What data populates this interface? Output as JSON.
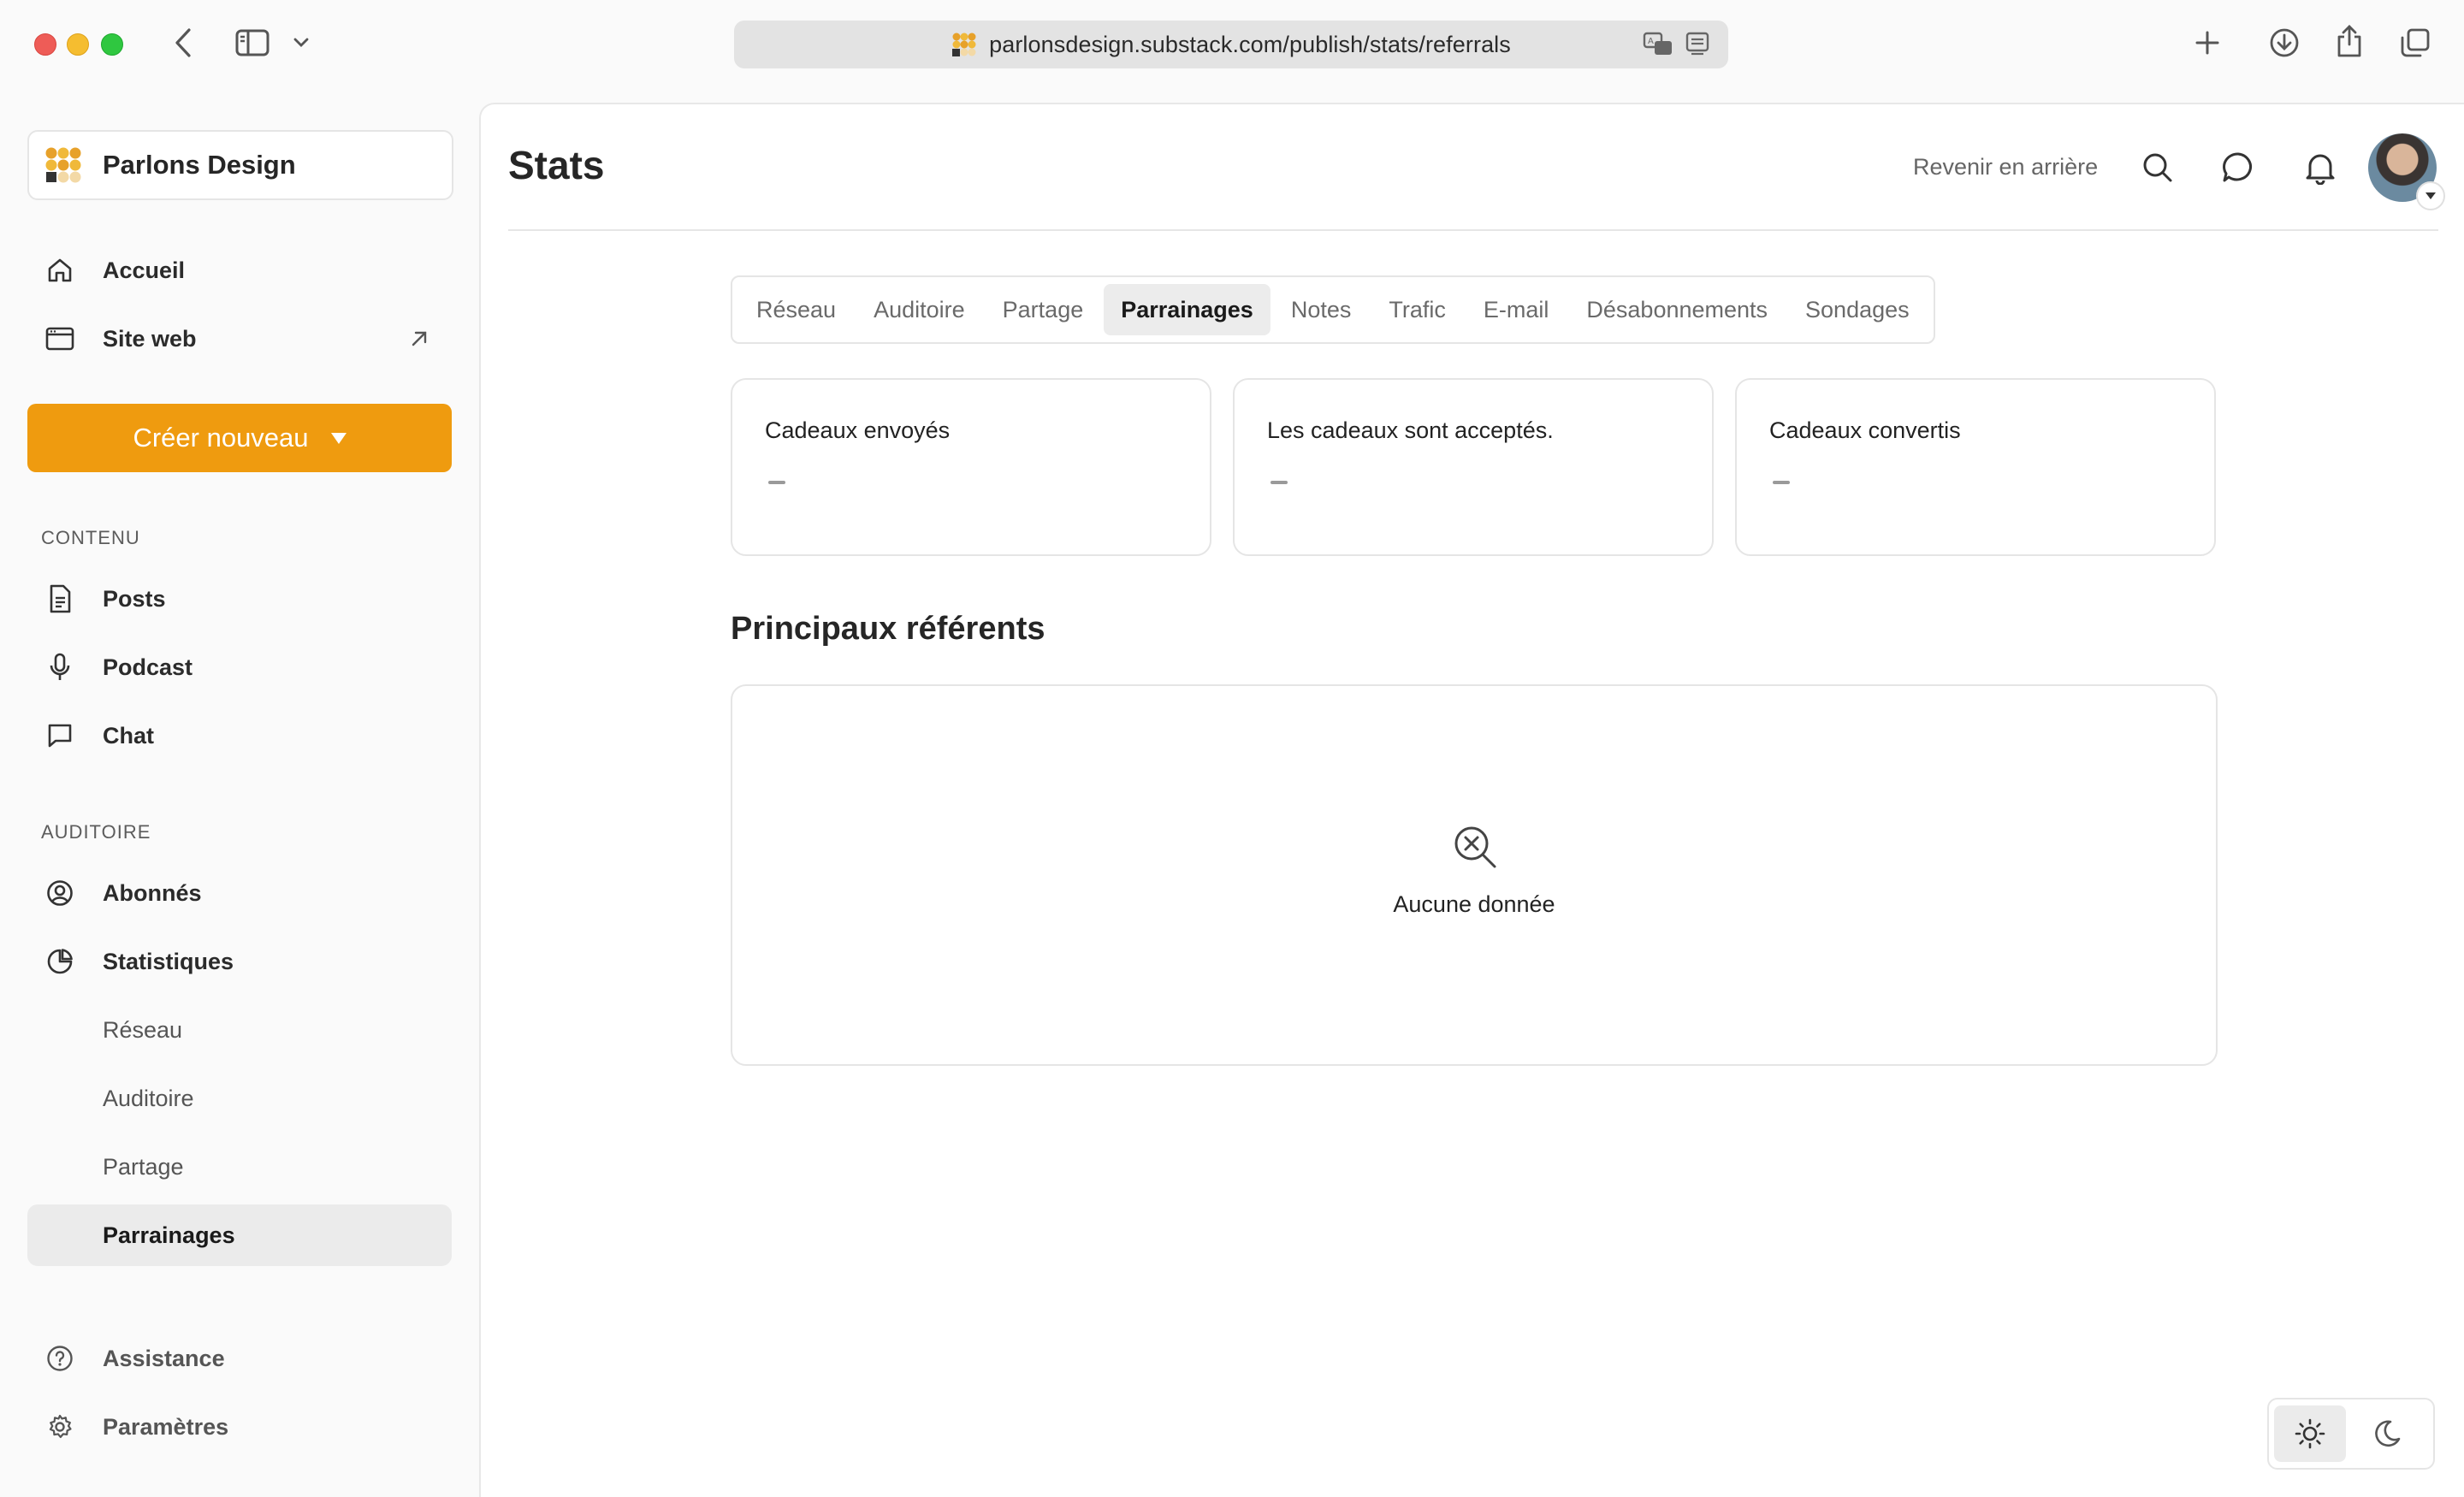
{
  "browser": {
    "url": "parlonsdesign.substack.com/publish/stats/referrals",
    "icons": [
      "back-icon",
      "sidebar-toggle-icon",
      "chevron-down-icon",
      "translate-icon",
      "reader-icon",
      "new-tab-icon",
      "download-icon",
      "share-icon",
      "tabs-overview-icon"
    ]
  },
  "sidebar": {
    "publication": {
      "name": "Parlons Design"
    },
    "top_items": [
      {
        "label": "Accueil",
        "icon": "home-icon"
      },
      {
        "label": "Site web",
        "icon": "website-icon"
      }
    ],
    "create_label": "Créer nouveau",
    "section_content": "CONTENU",
    "content_items": [
      {
        "label": "Posts",
        "icon": "document-icon"
      },
      {
        "label": "Podcast",
        "icon": "microphone-icon"
      },
      {
        "label": "Chat",
        "icon": "chat-icon"
      }
    ],
    "section_audience": "AUDITOIRE",
    "audience_items": [
      {
        "label": "Abonnés",
        "icon": "user-circle-icon"
      },
      {
        "label": "Statistiques",
        "icon": "pie-chart-icon"
      }
    ],
    "stats_subitems": [
      "Réseau",
      "Auditoire",
      "Partage",
      "Parrainages"
    ],
    "active_subitem": "Parrainages",
    "bottom_items": [
      {
        "label": "Assistance",
        "icon": "help-icon"
      },
      {
        "label": "Paramètres",
        "icon": "gear-icon"
      }
    ]
  },
  "header": {
    "title": "Stats",
    "back_link": "Revenir en arrière"
  },
  "tabs": {
    "items": [
      "Réseau",
      "Auditoire",
      "Partage",
      "Parrainages",
      "Notes",
      "Trafic",
      "E-mail",
      "Désabonnements",
      "Sondages"
    ],
    "active": "Parrainages"
  },
  "stats": [
    {
      "title": "Cadeaux envoyés",
      "value": "–"
    },
    {
      "title": "Les cadeaux sont acceptés.",
      "value": "–"
    },
    {
      "title": "Cadeaux convertis",
      "value": "–"
    }
  ],
  "referrers": {
    "title": "Principaux référents",
    "empty_text": "Aucune donnée"
  },
  "theme": {
    "active": "light"
  },
  "colors": {
    "accent": "#ef9b0f",
    "active_bg": "#ebebeb"
  }
}
